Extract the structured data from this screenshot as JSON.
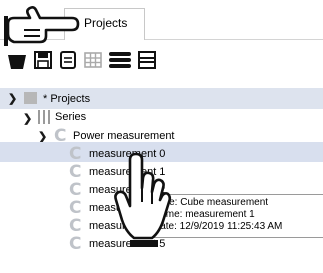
{
  "tab": {
    "label": "Projects"
  },
  "toolbar": {
    "icons": [
      "basket-icon",
      "save-icon",
      "document-icon",
      "grid-icon",
      "database-icon",
      "list-icon"
    ]
  },
  "tree": {
    "root": {
      "label": "* Projects"
    },
    "series": {
      "label": "Series"
    },
    "group": {
      "label": "Power measurement"
    },
    "items": [
      {
        "label": "measurement 0"
      },
      {
        "label": "measurement 1"
      },
      {
        "label": "measurement 2"
      },
      {
        "label": "measurement 3"
      },
      {
        "label": "measurement 4"
      },
      {
        "label": "measurement 5"
      }
    ]
  },
  "tooltip": {
    "type": "Type: Cube measurement",
    "name": "Name: measurement 1",
    "date": "Date: 12/9/2019 11:25:43 AM"
  },
  "colors": {
    "tree_header": "#dde3ee",
    "selected_row": "#d8dfee",
    "measurement_icon": "#bfc3c9"
  }
}
